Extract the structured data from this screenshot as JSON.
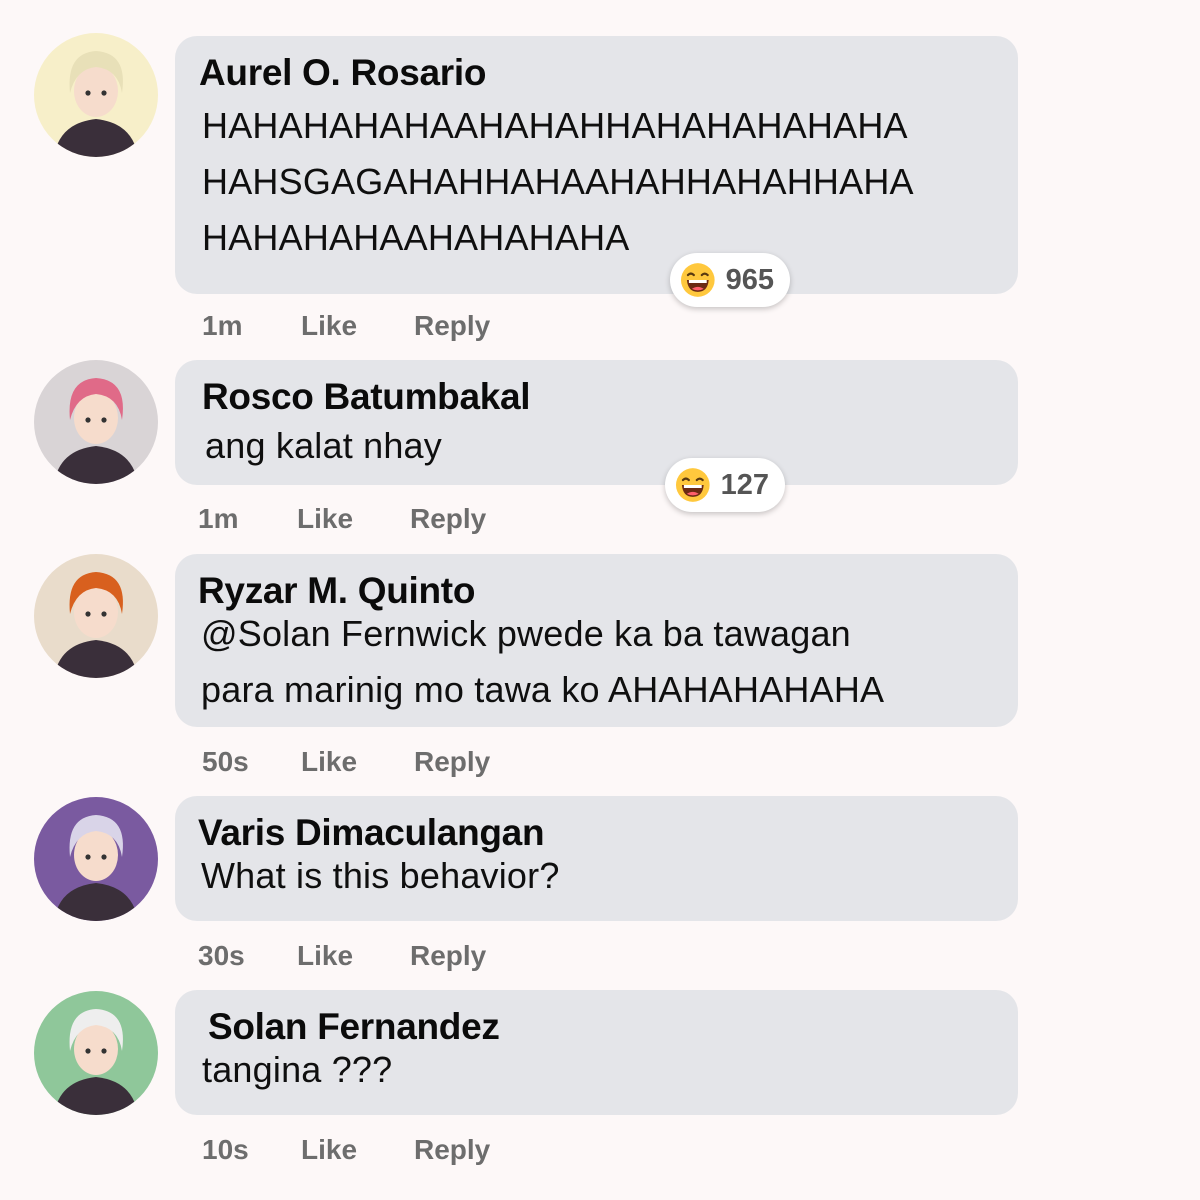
{
  "comments": [
    {
      "author": "Aurel O. Rosario",
      "text": "HAHAHAHAHAAHAHAHHAHAHAHAHAHA\nHAHSGAGAHAHHAHAAHAHHAHAHHAHA\nHAHAHAHAAHAHAHAHA",
      "reaction": {
        "icon": "laughing-emoji-icon",
        "count": "965"
      },
      "time": "1m",
      "like": "Like",
      "reply": "Reply",
      "avatar": {
        "icon": "avatar-blonde-character-icon",
        "bg": "#f7efc9",
        "hair": "#e8e0b8"
      }
    },
    {
      "author": "Rosco Batumbakal",
      "text": "ang kalat nhay",
      "reaction": {
        "icon": "laughing-emoji-icon",
        "count": "127"
      },
      "time": "1m",
      "like": "Like",
      "reply": "Reply",
      "avatar": {
        "icon": "avatar-pink-hair-character-icon",
        "bg": "#d9d4d6",
        "hair": "#e06a88"
      }
    },
    {
      "author": "Ryzar M. Quinto",
      "text": "@Solan Fernwick pwede ka ba tawagan\npara marinig mo tawa ko AHAHAHAHAHA",
      "time": "50s",
      "like": "Like",
      "reply": "Reply",
      "avatar": {
        "icon": "avatar-orange-hair-character-icon",
        "bg": "#e9dccb",
        "hair": "#d8601e"
      }
    },
    {
      "author": "Varis Dimaculangan",
      "text": "What is this behavior?",
      "time": "30s",
      "like": "Like",
      "reply": "Reply",
      "avatar": {
        "icon": "avatar-silver-hair-character-icon",
        "bg": "#7a5aa0",
        "hair": "#d9d4e8"
      }
    },
    {
      "author": "Solan Fernandez",
      "text": "tangina ???",
      "time": "10s",
      "like": "Like",
      "reply": "Reply",
      "avatar": {
        "icon": "avatar-hooded-character-icon",
        "bg": "#8fc79a",
        "hair": "#eeeeee"
      }
    }
  ],
  "colors": {
    "bubble": "#e4e5e9",
    "meta_text": "#6d6d6d",
    "page_bg": "#fdf8f8",
    "emoji": "#ffc83d"
  }
}
